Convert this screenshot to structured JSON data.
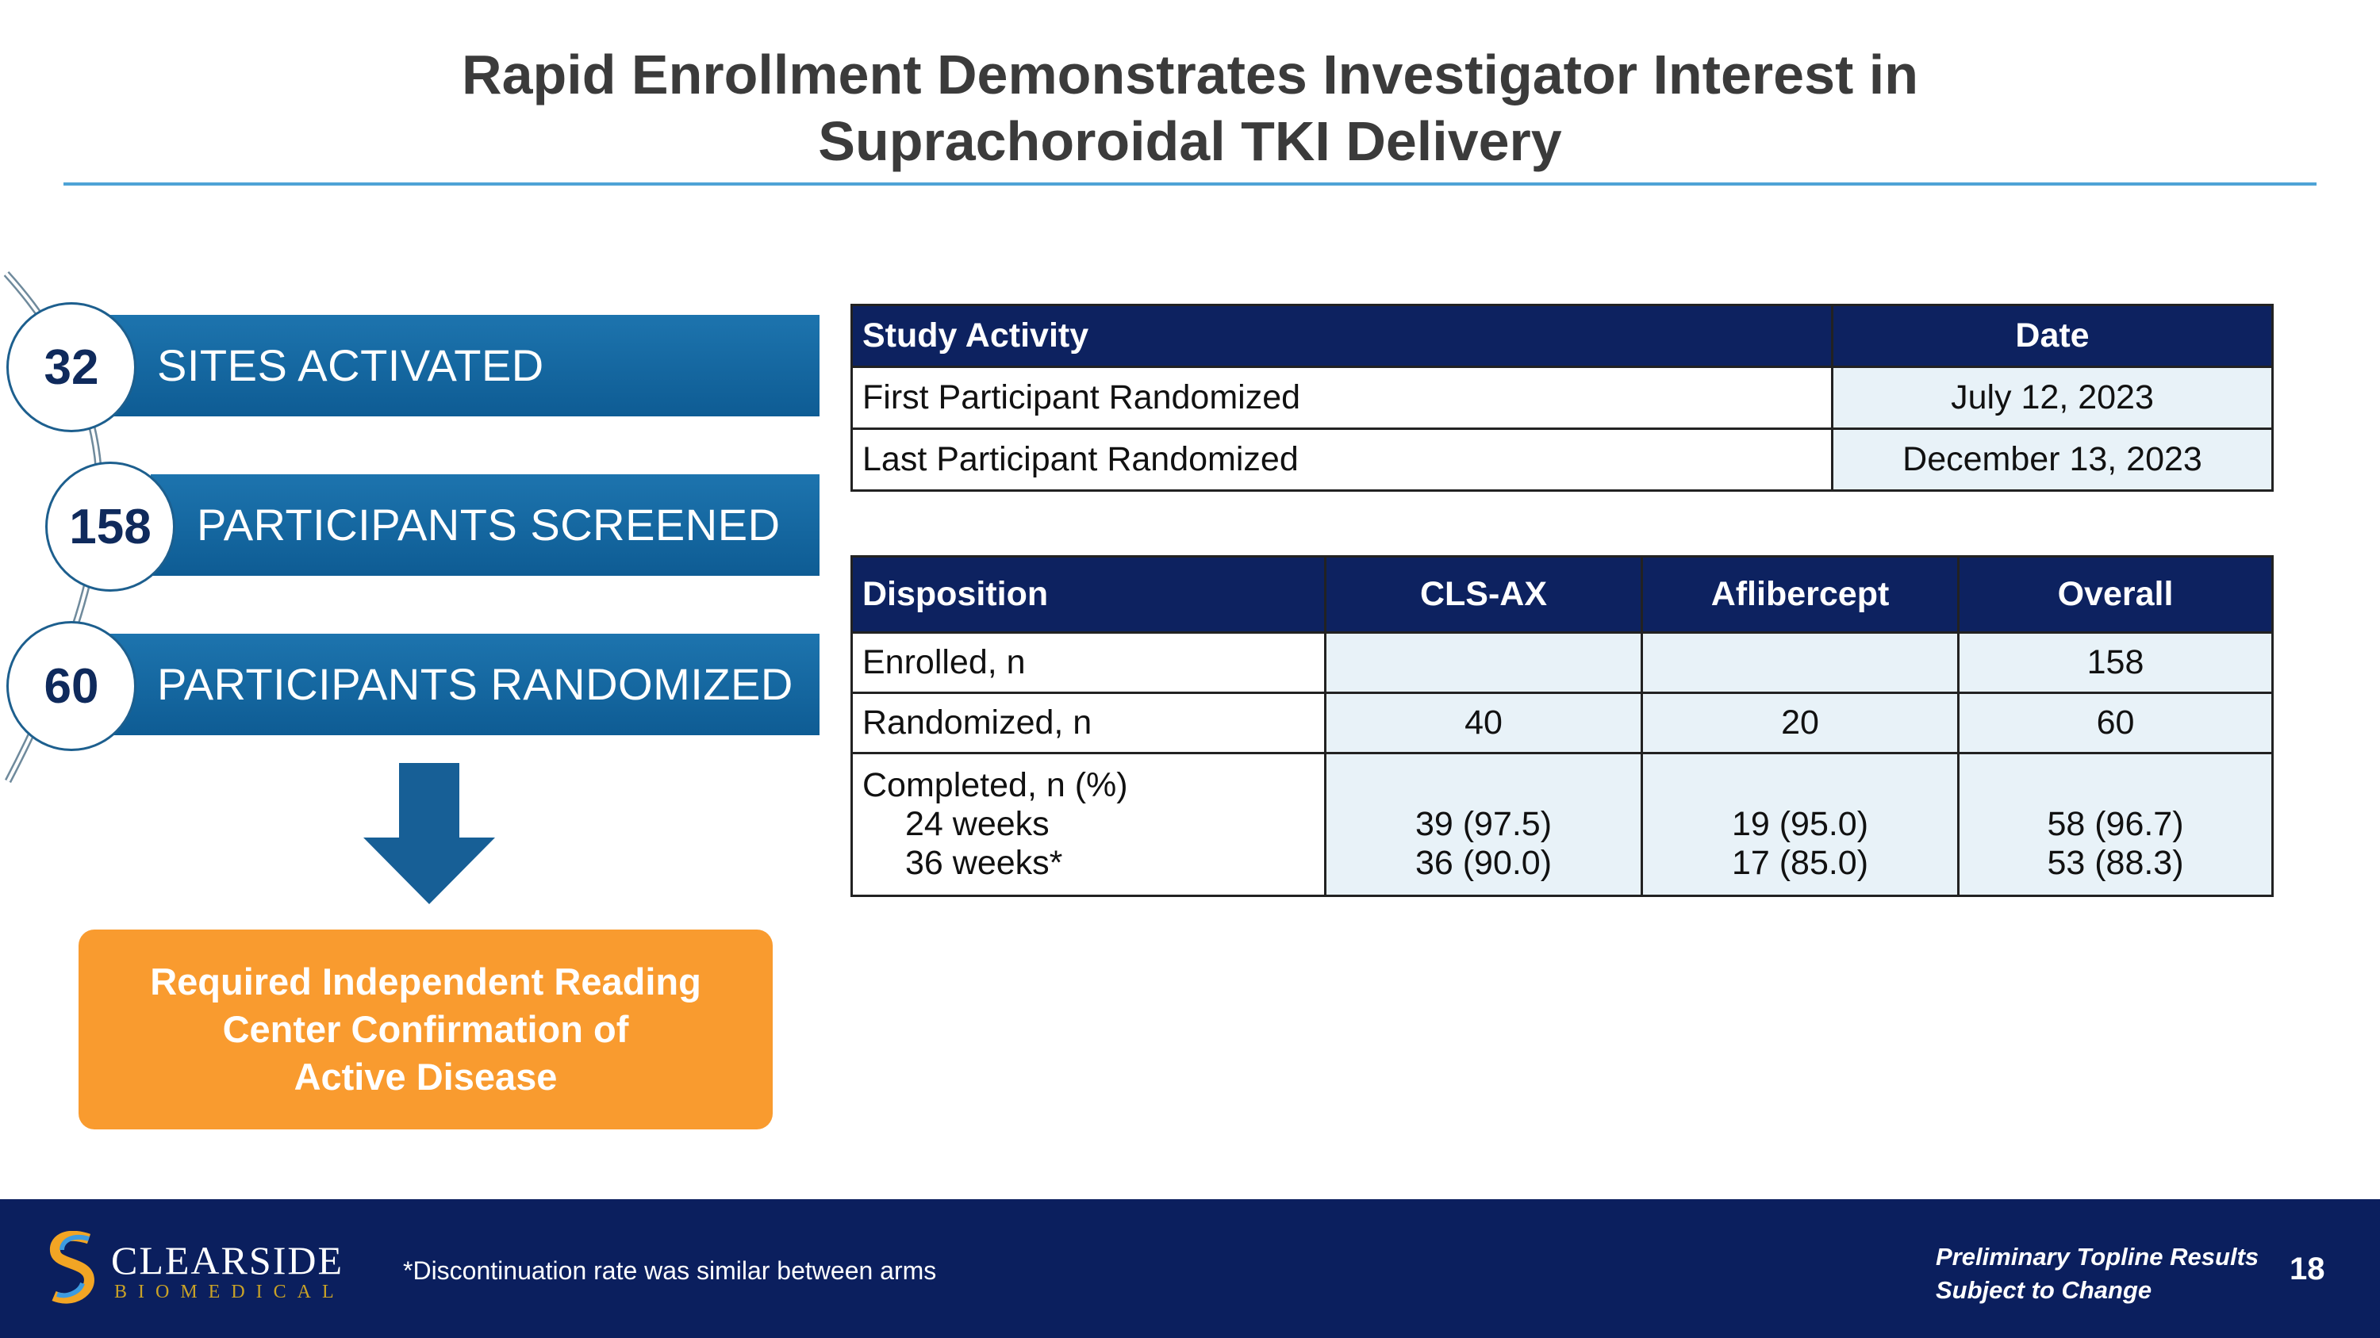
{
  "title_line1": "Rapid Enrollment Demonstrates Investigator Interest in",
  "title_line2": "Suprachoroidal TKI Delivery",
  "stats": [
    {
      "number": "32",
      "label": "SITES ACTIVATED"
    },
    {
      "number": "158",
      "label": "PARTICIPANTS SCREENED"
    },
    {
      "number": "60",
      "label": "PARTICIPANTS RANDOMIZED"
    }
  ],
  "callout": {
    "line1": "Required Independent Reading",
    "line2": "Center Confirmation of",
    "line3": "Active Disease"
  },
  "activity_table": {
    "headers": [
      "Study Activity",
      "Date"
    ],
    "rows": [
      [
        "First Participant Randomized",
        "July 12, 2023"
      ],
      [
        "Last Participant Randomized",
        "December 13, 2023"
      ]
    ]
  },
  "disposition_table": {
    "headers": [
      "Disposition",
      "CLS-AX",
      "Aflibercept",
      "Overall"
    ],
    "enrolled": {
      "label": "Enrolled, n",
      "cls_ax": "",
      "aflibercept": "",
      "overall": "158"
    },
    "randomized": {
      "label": "Randomized, n",
      "cls_ax": "40",
      "aflibercept": "20",
      "overall": "60"
    },
    "completed": {
      "label": "Completed, n (%)",
      "sub1": "24 weeks",
      "sub2": "36 weeks*",
      "cls_ax": [
        "39 (97.5)",
        "36 (90.0)"
      ],
      "aflibercept": [
        "19 (95.0)",
        "17 (85.0)"
      ],
      "overall": [
        "58 (96.7)",
        "53 (88.3)"
      ]
    }
  },
  "footer": {
    "logo_name": "CLEARSIDE",
    "logo_sub": "BIOMEDICAL",
    "footnote": "*Discontinuation rate was similar between arms",
    "disclaimer_line1": "Preliminary Topline Results",
    "disclaimer_line2": "Subject to Change",
    "page_number": "18"
  },
  "colors": {
    "header_navy": "#0d2260",
    "bar_blue": "#1d74ae",
    "callout_orange": "#f99b2f",
    "footer_navy": "#0b1f5e",
    "cell_shade": "#e8f2f8"
  }
}
